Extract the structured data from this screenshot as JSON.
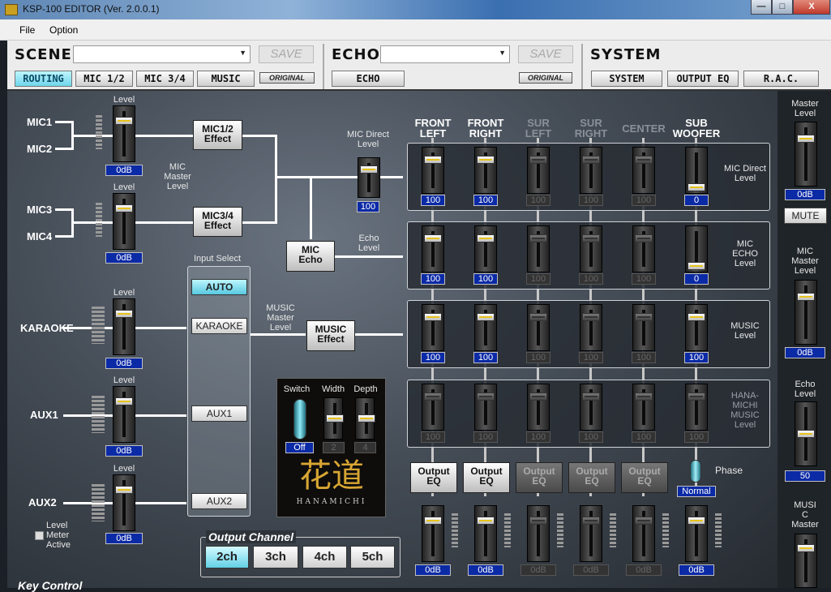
{
  "window": {
    "title": "KSP-100 EDITOR (Ver. 2.0.0.1)",
    "min": "—",
    "max": "□",
    "close": "X"
  },
  "menu": {
    "file": "File",
    "option": "Option"
  },
  "scene": {
    "title": "SCENE",
    "save": "SAVE",
    "original": "ORIGINAL",
    "tabs": [
      "ROUTING",
      "MIC 1/2",
      "MIC 3/4",
      "MUSIC"
    ]
  },
  "echo": {
    "title": "ECHO",
    "save": "SAVE",
    "original": "ORIGINAL",
    "tab": "ECHO"
  },
  "system": {
    "title": "SYSTEM",
    "tabs": [
      "SYSTEM",
      "OUTPUT EQ",
      "R.A.C."
    ]
  },
  "inputs": {
    "mic1": "MIC1",
    "mic2": "MIC2",
    "mic3": "MIC3",
    "mic4": "MIC4",
    "karaoke": "KARAOKE",
    "aux1": "AUX1",
    "aux2": "AUX2"
  },
  "input_faders": [
    {
      "label": "Level",
      "value": "0dB",
      "level": 0.8
    },
    {
      "label": "Level",
      "value": "0dB",
      "level": 0.8
    },
    {
      "label": "Level",
      "value": "0dB",
      "level": 0.8
    },
    {
      "label": "Level",
      "value": "0dB",
      "level": 0.8
    },
    {
      "label": "Level",
      "value": "0dB",
      "level": 0.8
    }
  ],
  "mic_master": "MIC\nMaster\nLevel",
  "effects": {
    "mic12": "MIC1/2\nEffect",
    "mic34": "MIC3/4\nEffect",
    "micecho": "MIC\nEcho",
    "music": "MUSIC\nEffect"
  },
  "mic_direct": {
    "label": "MIC Direct\nLevel",
    "value": "100",
    "level": 0.8
  },
  "echo_level": "Echo\nLevel",
  "music_master": "MUSIC\nMaster\nLevel",
  "input_select": {
    "title": "Input Select",
    "buttons": [
      "AUTO",
      "KARAOKE",
      "AUX1",
      "AUX2"
    ],
    "active": "AUTO"
  },
  "level_meter": "Level\nMeter\nActive",
  "hanamichi": {
    "switch": "Switch",
    "width": "Width",
    "depth": "Depth",
    "switch_value": "Off",
    "width_value": "2",
    "depth_value": "4",
    "logo": "花道",
    "logo_sub": "HANAMICHI"
  },
  "output_channel": {
    "title": "Output Channel",
    "buttons": [
      "2ch",
      "3ch",
      "4ch",
      "5ch"
    ],
    "active": "2ch"
  },
  "key_control": "Key Control",
  "columns": [
    {
      "label": "FRONT\nLEFT",
      "active": true
    },
    {
      "label": "FRONT\nRIGHT",
      "active": true
    },
    {
      "label": "SUR\nLEFT",
      "active": false
    },
    {
      "label": "SUR\nRIGHT",
      "active": false
    },
    {
      "label": "CENTER",
      "active": false
    },
    {
      "label": "SUB\nWOOFER",
      "active": true
    }
  ],
  "rows": [
    {
      "label": "MIC Direct\nLevel",
      "values": [
        "100",
        "100",
        "100",
        "100",
        "100",
        "0"
      ],
      "levels": [
        0.8,
        0.8,
        0.8,
        0.8,
        0.8,
        0.0
      ]
    },
    {
      "label": "MIC\nECHO\nLevel",
      "values": [
        "100",
        "100",
        "100",
        "100",
        "100",
        "0"
      ],
      "levels": [
        0.8,
        0.8,
        0.8,
        0.8,
        0.8,
        0.0
      ]
    },
    {
      "label": "MUSIC\nLevel",
      "values": [
        "100",
        "100",
        "100",
        "100",
        "100",
        "100"
      ],
      "levels": [
        0.8,
        0.8,
        0.8,
        0.8,
        0.8,
        0.8
      ]
    },
    {
      "label": "HANA-\nMICHI\nMUSIC\nLevel",
      "values": [
        "100",
        "100",
        "100",
        "100",
        "100",
        "100"
      ],
      "levels": [
        0.8,
        0.8,
        0.8,
        0.8,
        0.8,
        0.8
      ],
      "dim": true
    }
  ],
  "output_eq": "Output\nEQ",
  "output_faders": {
    "values": [
      "0dB",
      "0dB",
      "0dB",
      "0dB",
      "0dB",
      "0dB"
    ],
    "levels": [
      0.8,
      0.8,
      0.8,
      0.8,
      0.8,
      0.8
    ]
  },
  "phase": {
    "label": "Phase",
    "value": "Normal"
  },
  "side": {
    "master": "Master\nLevel",
    "master_value": "0dB",
    "mute": "MUTE",
    "mic_master": "MIC\nMaster\nLevel",
    "mic_master_value": "0dB",
    "echo": "Echo\nLevel",
    "echo_value": "50",
    "music": "MUSI\nC\nMaster"
  },
  "colors": {
    "accent": "#6fd6ea",
    "value_bg": "#0b2aa6",
    "panel": "#454d57"
  }
}
